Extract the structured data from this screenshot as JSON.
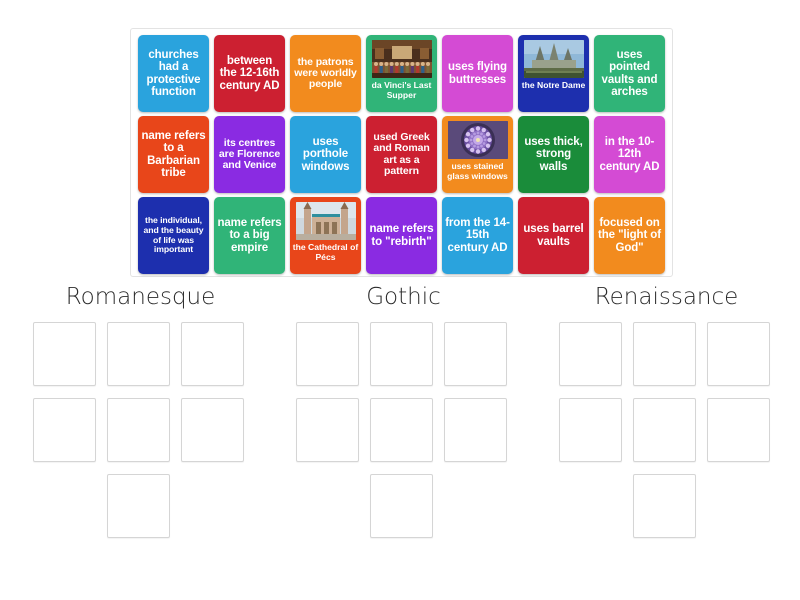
{
  "activity": {
    "type": "group-sort",
    "tray_tile_count": 21
  },
  "tray": {
    "tiles": [
      {
        "id": "t1",
        "text": "churches had a protective function",
        "color": "#2aa3dd",
        "size": "md",
        "kind": "text"
      },
      {
        "id": "t2",
        "text": "between the 12-16th century AD",
        "color": "#cc2031",
        "size": "md",
        "kind": "text"
      },
      {
        "id": "t3",
        "text": "the patrons were worldly people",
        "color": "#f28b1e",
        "size": "sm",
        "kind": "text"
      },
      {
        "id": "t4",
        "text": "da Vinci's Last Supper",
        "color": "#30b478",
        "size": "sm",
        "kind": "image",
        "image": "da-vinci-last-supper-photo"
      },
      {
        "id": "t5",
        "text": "uses flying buttresses",
        "color": "#d44bd4",
        "size": "md",
        "kind": "text"
      },
      {
        "id": "t6",
        "text": "the Notre Dame",
        "color": "#1d2fae",
        "size": "sm",
        "kind": "image",
        "image": "notre-dame-photo"
      },
      {
        "id": "t7",
        "text": "uses pointed vaults and arches",
        "color": "#30b478",
        "size": "md",
        "kind": "text"
      },
      {
        "id": "t8",
        "text": "name refers to a Barbarian tribe",
        "color": "#e8461a",
        "size": "md",
        "kind": "text"
      },
      {
        "id": "t9",
        "text": "its centres are Florence and Venice",
        "color": "#8a2be2",
        "size": "sm",
        "kind": "text"
      },
      {
        "id": "t10",
        "text": "uses porthole windows",
        "color": "#2aa3dd",
        "size": "md",
        "kind": "text"
      },
      {
        "id": "t11",
        "text": "used Greek and Roman art as a pattern",
        "color": "#cc2031",
        "size": "sm",
        "kind": "text"
      },
      {
        "id": "t12",
        "text": "uses stained glass windows",
        "color": "#f28b1e",
        "size": "sm",
        "kind": "image",
        "image": "rose-stained-glass-window-photo"
      },
      {
        "id": "t13",
        "text": "uses thick, strong walls",
        "color": "#1a8c3a",
        "size": "md",
        "kind": "text"
      },
      {
        "id": "t14",
        "text": "in the 10-12th century AD",
        "color": "#d44bd4",
        "size": "md",
        "kind": "text"
      },
      {
        "id": "t15",
        "text": "the individual, and the beauty of life was important",
        "color": "#1d2fae",
        "size": "xs",
        "kind": "text"
      },
      {
        "id": "t16",
        "text": "name refers to a big empire",
        "color": "#30b478",
        "size": "md",
        "kind": "text"
      },
      {
        "id": "t17",
        "text": "the Cathedral of Pécs",
        "color": "#e8461a",
        "size": "sm",
        "kind": "image",
        "image": "cathedral-of-pecs-photo"
      },
      {
        "id": "t18",
        "text": "name refers to \"rebirth\"",
        "color": "#8a2be2",
        "size": "md",
        "kind": "text"
      },
      {
        "id": "t19",
        "text": "from the 14-15th century AD",
        "color": "#2aa3dd",
        "size": "md",
        "kind": "text"
      },
      {
        "id": "t20",
        "text": "uses barrel vaults",
        "color": "#cc2031",
        "size": "md",
        "kind": "text"
      },
      {
        "id": "t21",
        "text": "focused on the \"light of God\"",
        "color": "#f28b1e",
        "size": "md",
        "kind": "text"
      }
    ]
  },
  "categories": [
    {
      "title": "Romanesque",
      "slot_rows": [
        3,
        3,
        1
      ],
      "filled": []
    },
    {
      "title": "Gothic",
      "slot_rows": [
        3,
        3,
        1
      ],
      "filled": []
    },
    {
      "title": "Renaissance",
      "slot_rows": [
        3,
        3,
        1
      ],
      "filled": []
    }
  ],
  "colors": {
    "page_background": "#ffffff",
    "tray_border": "#e3e3e3",
    "slot_border": "#d5d5d5",
    "heading_text": "#2b2b2b",
    "tile_text": "#ffffff"
  }
}
